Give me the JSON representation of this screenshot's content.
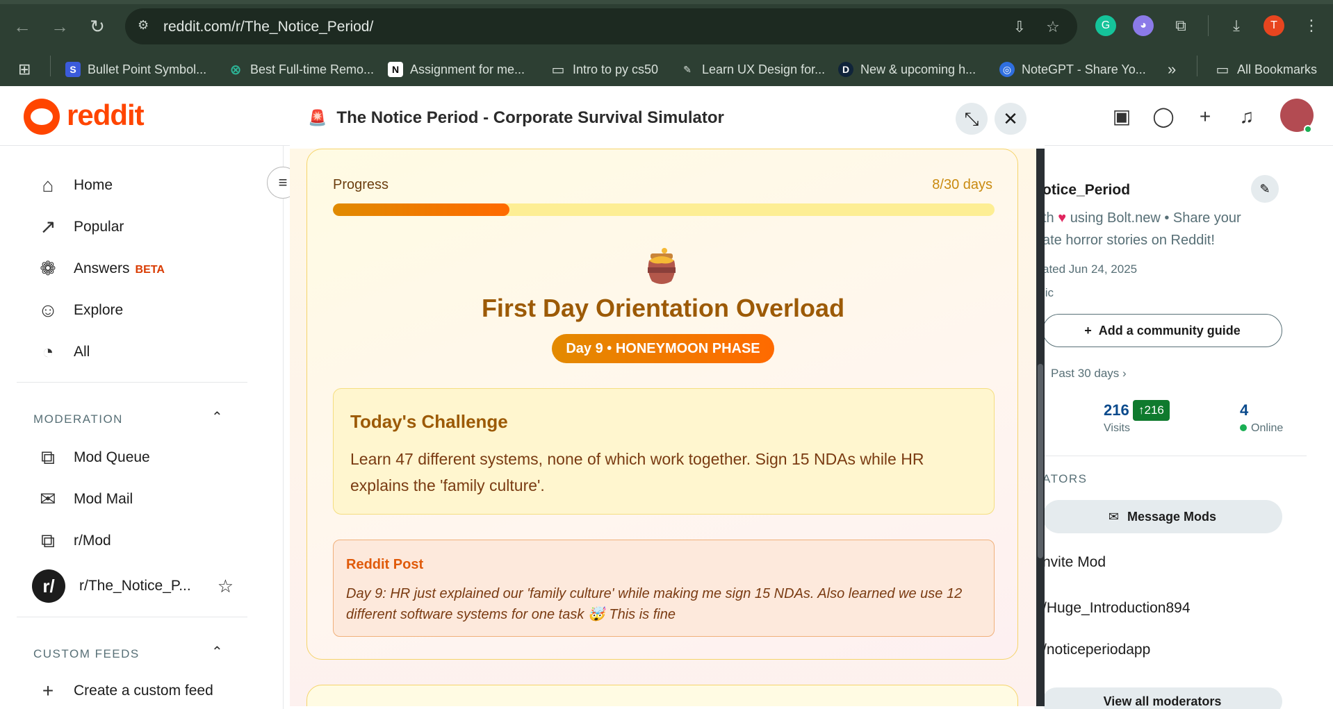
{
  "browser": {
    "url": "reddit.com/r/The_Notice_Period/",
    "profile_initial": "T",
    "bookmarks": [
      {
        "label": "Bullet Point Symbol...",
        "icon": "S",
        "color": "#3b5bdb"
      },
      {
        "label": "Best Full-time Remo...",
        "icon": "⊗",
        "color": "#2db89a"
      },
      {
        "label": "Assignment for me...",
        "icon": "N",
        "color": "#ffffff"
      },
      {
        "label": "Intro to py cs50",
        "icon": "folder",
        "color": "#d8e0da"
      },
      {
        "label": "Learn UX Design for...",
        "icon": "✎",
        "color": "#d8e0da"
      },
      {
        "label": "New & upcoming h...",
        "icon": "D",
        "color": "#10243a"
      },
      {
        "label": "NoteGPT - Share Yo...",
        "icon": "◎",
        "color": "#2f6fe0"
      }
    ],
    "more_bookmarks": "»",
    "all_bookmarks": "All Bookmarks"
  },
  "reddit": {
    "logo_text": "reddit",
    "sidebar": {
      "items": [
        {
          "label": "Home",
          "icon": "home-icon"
        },
        {
          "label": "Popular",
          "icon": "popular-icon"
        },
        {
          "label": "Answers",
          "icon": "answers-icon",
          "badge": "BETA"
        },
        {
          "label": "Explore",
          "icon": "explore-icon"
        },
        {
          "label": "All",
          "icon": "all-icon"
        }
      ],
      "moderation_heading": "MODERATION",
      "mod_items": [
        {
          "label": "Mod Queue"
        },
        {
          "label": "Mod Mail"
        },
        {
          "label": "r/Mod"
        },
        {
          "label": "r/The_Notice_P..."
        }
      ],
      "custom_feeds_heading": "CUSTOM FEEDS",
      "create_feed": "Create a custom feed"
    },
    "right": {
      "title": "otice_Period",
      "desc_a": "th",
      "desc_b": "using Bolt.new • Share your",
      "desc_c": "ate horror stories on Reddit!",
      "created": "ated Jun 24, 2025",
      "visibility": "lic",
      "guide_btn": "Add a community guide",
      "period": "Past 30 days",
      "visits_num": "216",
      "visits_badge": "↑216",
      "visits_label": "Visits",
      "online_num": "4",
      "online_label": "Online",
      "mods_heading": "ATORS",
      "message_mods": "Message Mods",
      "invite_mod": "nvite Mod",
      "mod1": "/Huge_Introduction894",
      "mod2": "/noticeperiodapp",
      "view_all": "View all moderators"
    }
  },
  "modal": {
    "title": "The Notice Period - Corporate Survival Simulator",
    "progress_label": "Progress",
    "progress_days": "8/30 days",
    "progress_fraction": 0.2667,
    "day_title": "First Day Orientation Overload",
    "phase_pill": "Day 9 • HONEYMOON PHASE",
    "challenge_title": "Today's Challenge",
    "challenge_text": "Learn 47 different systems, none of which work together. Sign 15 NDAs while HR explains the 'family culture'.",
    "post_title": "Reddit Post",
    "post_text": "Day 9: HR just explained our 'family culture' while making me sign 15 NDAs. Also learned we use 12 different software systems for one task 🤯 This is fine"
  }
}
